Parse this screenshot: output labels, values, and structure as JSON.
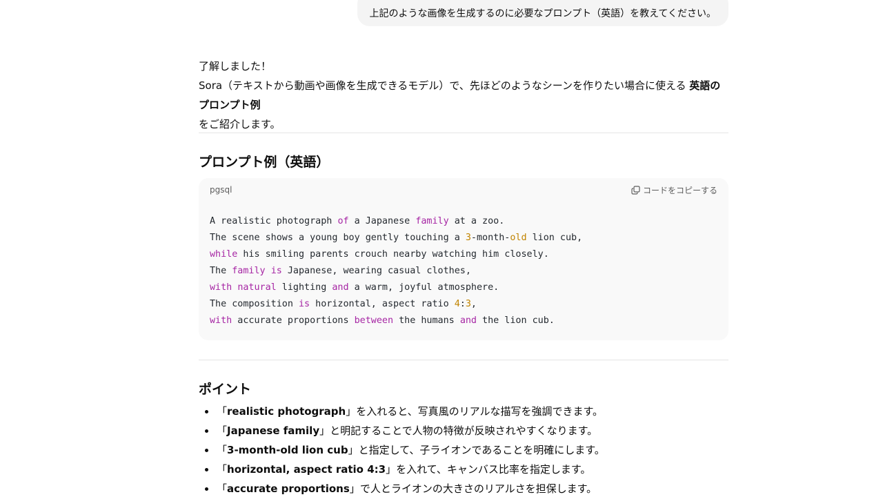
{
  "user_message": "上記のような画像を生成するのに必要なプロンプト（英語）を教えてください。",
  "intro": {
    "line1": "了解しました！",
    "line2_pre": "Sora（テキストから動画や画像を生成できるモデル）で、先ほどのようなシーンを作りたい場合に使える ",
    "line2_bold": "英語のプロンプト例",
    "line3": "をご紹介します。"
  },
  "section_prompt": {
    "heading": "プロンプト例（英語）",
    "code_lang": "pgsql",
    "copy_label": "コードをコピーする",
    "copy_icon": "copy-icon",
    "code_lines": [
      [
        [
          "t",
          "A realistic photograph "
        ],
        [
          "k",
          "of"
        ],
        [
          "t",
          " a Japanese "
        ],
        [
          "k",
          "family"
        ],
        [
          "t",
          " at a zoo."
        ]
      ],
      [
        [
          "t",
          "The scene shows a young boy gently touching a "
        ],
        [
          "n",
          "3"
        ],
        [
          "t",
          "-month-"
        ],
        [
          "n",
          "old"
        ],
        [
          "t",
          " lion cub,"
        ]
      ],
      [
        [
          "k",
          "while"
        ],
        [
          "t",
          " his smiling parents crouch nearby watching him closely."
        ]
      ],
      [
        [
          "t",
          "The "
        ],
        [
          "k",
          "family"
        ],
        [
          "t",
          " "
        ],
        [
          "k",
          "is"
        ],
        [
          "t",
          " Japanese, wearing casual clothes,"
        ]
      ],
      [
        [
          "k",
          "with"
        ],
        [
          "t",
          " "
        ],
        [
          "k",
          "natural"
        ],
        [
          "t",
          " lighting "
        ],
        [
          "k",
          "and"
        ],
        [
          "t",
          " a warm, joyful atmosphere."
        ]
      ],
      [
        [
          "t",
          "The composition "
        ],
        [
          "k",
          "is"
        ],
        [
          "t",
          " horizontal, aspect ratio "
        ],
        [
          "n",
          "4"
        ],
        [
          "t",
          ":"
        ],
        [
          "n",
          "3"
        ],
        [
          "t",
          ","
        ]
      ],
      [
        [
          "k",
          "with"
        ],
        [
          "t",
          " accurate proportions "
        ],
        [
          "k",
          "between"
        ],
        [
          "t",
          " the humans "
        ],
        [
          "k",
          "and"
        ],
        [
          "t",
          " the lion cub."
        ]
      ]
    ],
    "colors": {
      "keyword": "#a626a4",
      "number": "#c18401",
      "code_bg": "#f9f9f9"
    }
  },
  "section_points": {
    "heading": "ポイント",
    "items": [
      {
        "open": "「",
        "bold": "realistic photograph",
        "close": "」",
        "rest": "を入れると、写真風のリアルな描写を強調できます。"
      },
      {
        "open": "「",
        "bold": "Japanese family",
        "close": "」",
        "rest": "と明記することで人物の特徴が反映されやすくなります。"
      },
      {
        "open": "「",
        "bold": "3-month-old lion cub",
        "close": "」",
        "rest": "と指定して、子ライオンであることを明確にします。"
      },
      {
        "open": "「",
        "bold": "horizontal, aspect ratio 4:3",
        "close": "」",
        "rest": "を入れて、キャンバス比率を指定します。"
      },
      {
        "open": "「",
        "bold": "accurate proportions",
        "close": "」",
        "rest": "で人とライオンの大きさのリアルさを担保します。"
      }
    ]
  }
}
